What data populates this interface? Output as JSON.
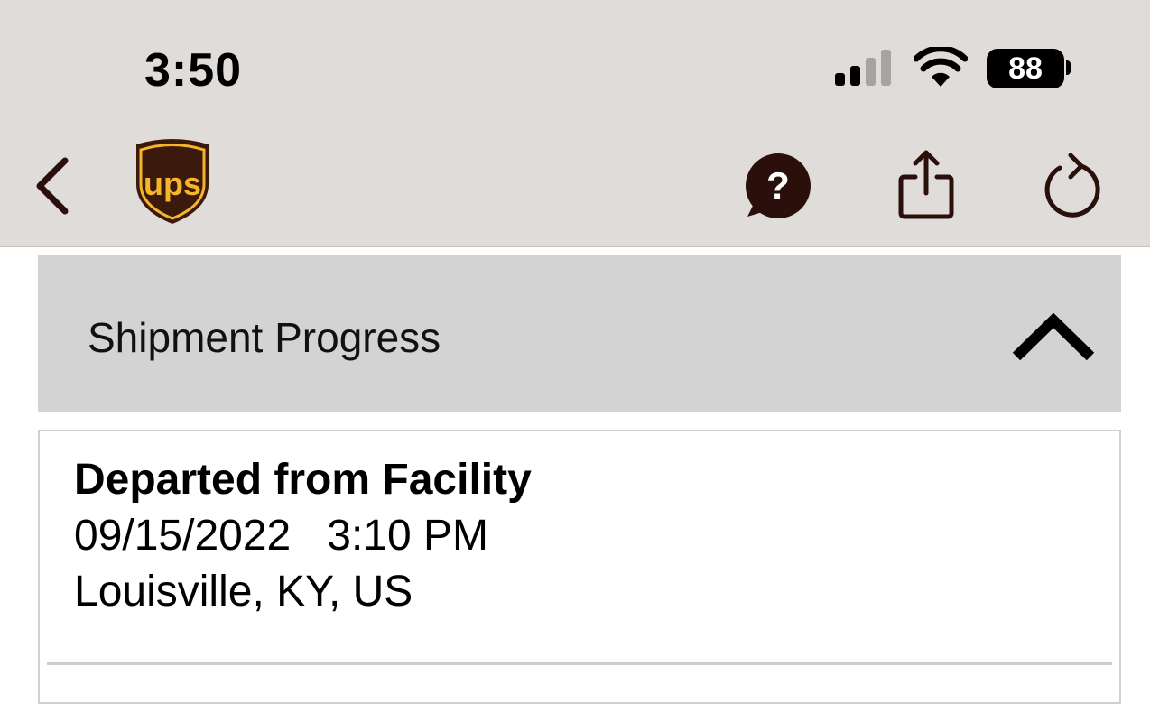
{
  "status_bar": {
    "time": "3:50",
    "battery": "88"
  },
  "nav": {
    "logo_text": "ups",
    "icons": [
      "back-icon",
      "ups-logo",
      "help-chat-icon",
      "share-icon",
      "refresh-icon"
    ]
  },
  "section": {
    "title": "Shipment Progress",
    "expanded": true
  },
  "events": [
    {
      "status": "Departed from Facility",
      "date": "09/15/2022",
      "time": "3:10 PM",
      "datetime": "09/15/2022   3:10 PM",
      "location": "Louisville, KY, US"
    }
  ],
  "colors": {
    "header_bg": "#e0dcd9",
    "section_bg": "#d3d3d3",
    "ups_brown": "#3b1a0d",
    "ups_gold": "#f5b52a",
    "icon_dark": "#2a0f0a"
  }
}
